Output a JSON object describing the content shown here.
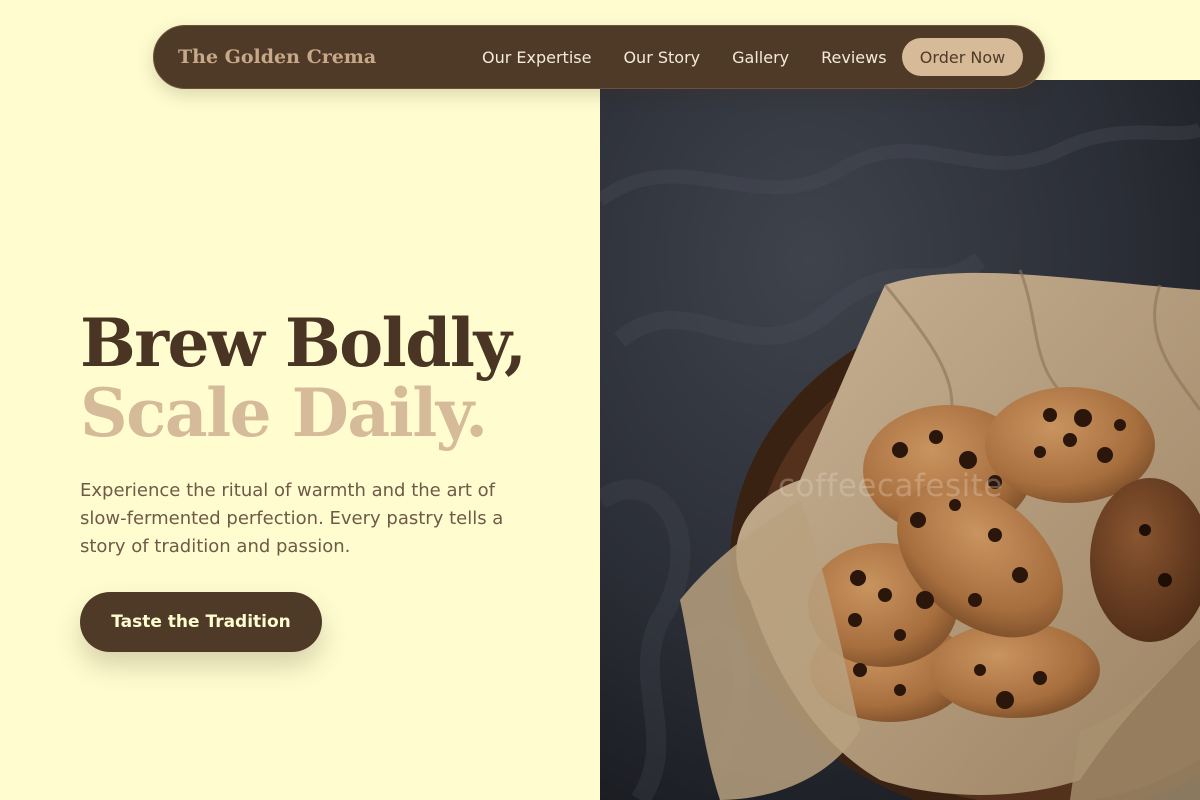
{
  "brand": {
    "name": "The Golden Crema"
  },
  "nav": {
    "links": [
      {
        "label": "Our Expertise"
      },
      {
        "label": "Our Story"
      },
      {
        "label": "Gallery"
      },
      {
        "label": "Reviews"
      }
    ],
    "order_button": "Order Now"
  },
  "hero": {
    "headline_line1": "Brew Boldly,",
    "headline_line2": "Scale Daily.",
    "description": "Experience the ritual of warmth and the art of slow-fermented perfection. Every pastry tells a story of tradition and passion.",
    "cta_label": "Taste the Tradition",
    "image": {
      "subject": "chocolate-chip-cookies-in-bowl",
      "watermark": "coffeecafesite"
    }
  },
  "colors": {
    "background": "#fffdd0",
    "dark_brown": "#4f3a27",
    "heading_dark": "#4a3524",
    "accent_tan": "#d5bb99",
    "body_text": "#6e5a47"
  }
}
